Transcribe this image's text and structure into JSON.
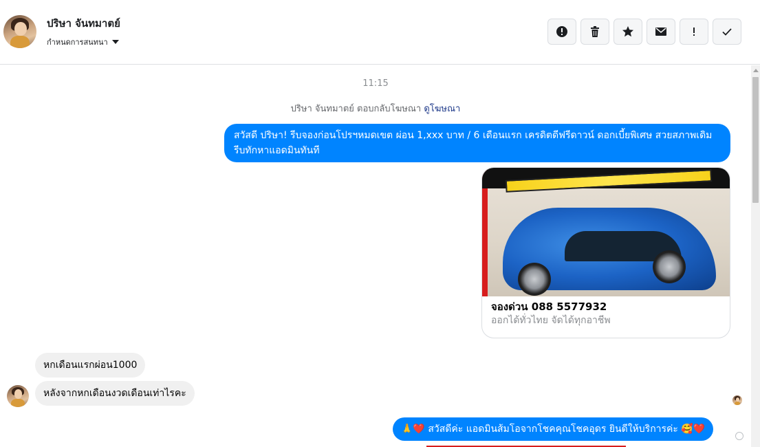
{
  "header": {
    "contact_name": "ปริษา จันทมาตย์",
    "conversation_action": "กำหนดการสนทนา",
    "toolbar": [
      {
        "name": "report-button",
        "icon": "alert-circle-icon"
      },
      {
        "name": "delete-button",
        "icon": "trash-icon"
      },
      {
        "name": "star-button",
        "icon": "star-icon"
      },
      {
        "name": "mark-unread-button",
        "icon": "envelope-icon"
      },
      {
        "name": "mark-spam-button",
        "icon": "exclamation-icon"
      },
      {
        "name": "mark-done-button",
        "icon": "check-icon"
      }
    ]
  },
  "thread": {
    "timestamp": "11:15",
    "ad_reply_prefix": "ปริษา จันทมาตย์ ตอบกลับโฆษณา",
    "ad_reply_link": "ดูโฆษณา",
    "messages": {
      "outgoing_1": "สวัสดี ปริษา! รีบจองก่อนโปรฯหมดเขต ผ่อน 1,xxx บาท / 6 เดือนแรก เครดิตดีฟรีดาวน์ ดอกเบี้ยพิเศษ สวยสภาพเดิม รีบทักหาแอดมินทันที",
      "incoming_1": "หกเดือนแรกผ่อน1000",
      "incoming_2": "หลังจากหกเดือนงวดเดือนเท่าไรคะ",
      "outgoing_2": "🙏❤️ สวัสดีค่ะ แอดมินส้มโอจากโชคคุณโชคอุดร ยินดีให้บริการค่ะ 🥰❤️"
    },
    "ad_card": {
      "title": "จองด่วน 088 5577932",
      "subtitle": "ออกได้ทั่วไทย จัดได้ทุกอาชีพ"
    }
  },
  "colors": {
    "outgoing_bubble": "#0084ff",
    "incoming_bubble": "#f0f0f0",
    "link": "#1f3a8a"
  }
}
